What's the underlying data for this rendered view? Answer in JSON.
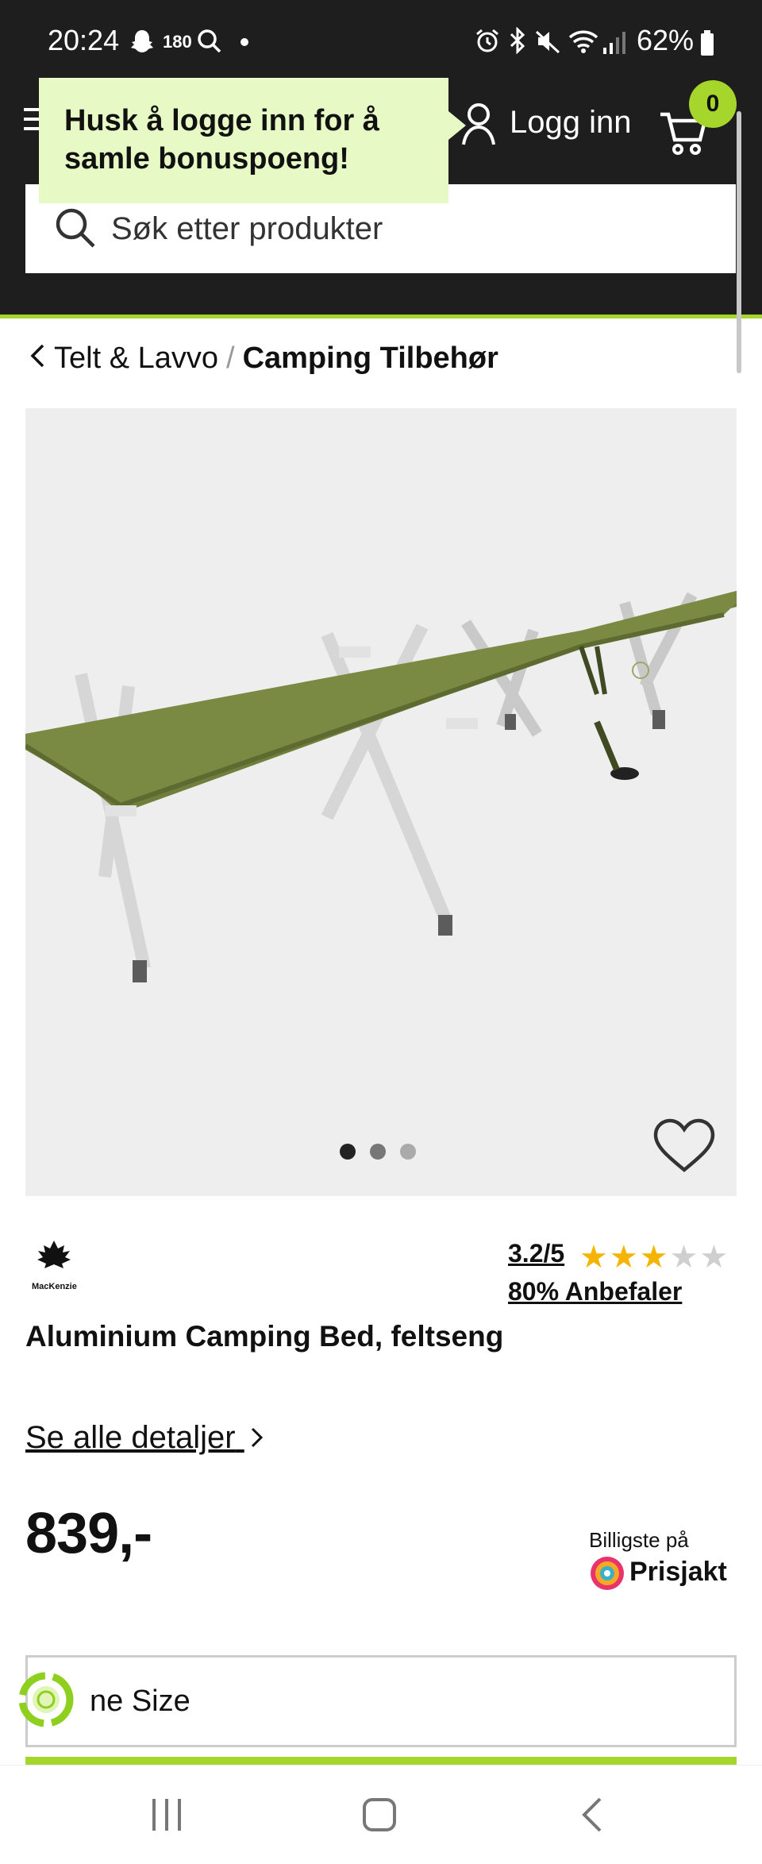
{
  "status_bar": {
    "time": "20:24",
    "notification_count": "180",
    "battery": "62%"
  },
  "header": {
    "login_label": "Logg inn",
    "cart_count": "0",
    "tooltip_text": "Husk å logge inn for å samle bonuspoeng!",
    "search_placeholder": "Søk etter produkter"
  },
  "breadcrumb": {
    "parent": "Telt & Lavvo",
    "separator": "/",
    "current": "Camping Tilbehør"
  },
  "gallery": {
    "images_total": 3,
    "active_index": 0
  },
  "product": {
    "brand": "MacKenzie",
    "rating": "3.2/5",
    "rating_value": 3.2,
    "recommend": "80% Anbefaler",
    "title": "Aluminium Camping Bed, feltseng",
    "details_link": "Se alle detaljer",
    "price": "839,-",
    "prisjakt_label": "Billigste på",
    "prisjakt_brand": "Prisjakt",
    "size": "ne Size"
  },
  "colors": {
    "accent": "#a6d62b",
    "header_bg": "#1e1e1e",
    "tooltip_bg": "#e7f9c5",
    "star": "#f5b400"
  }
}
